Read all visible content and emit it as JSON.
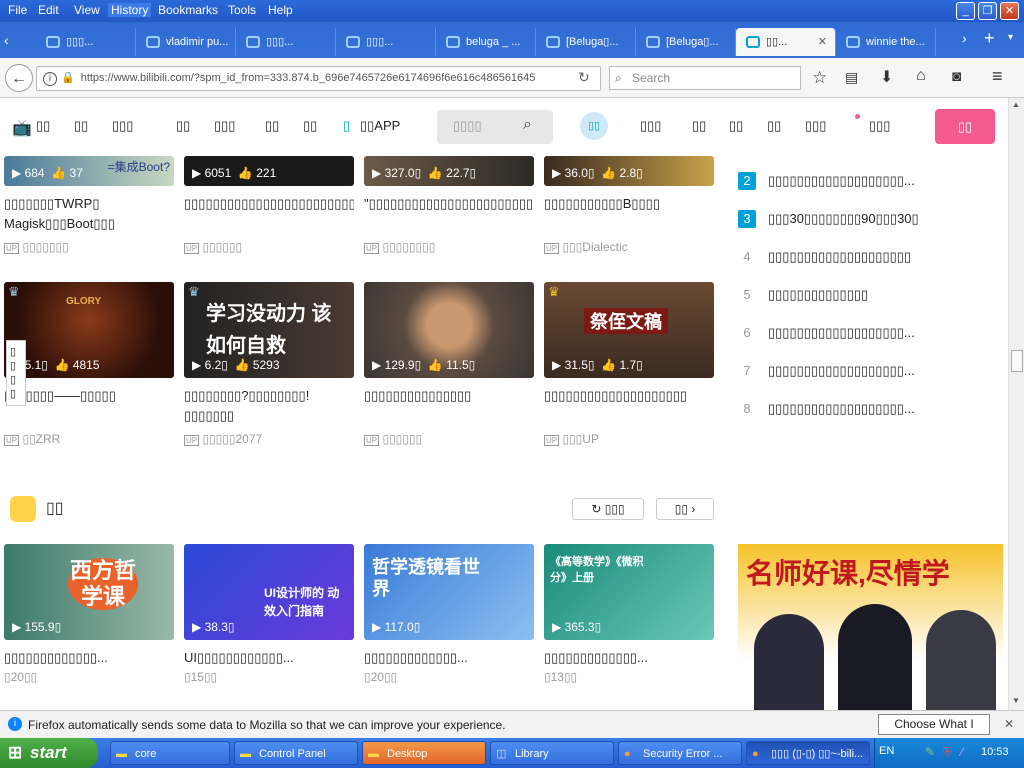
{
  "menubar": {
    "items": [
      "File",
      "Edit",
      "View",
      "History",
      "Bookmarks",
      "Tools",
      "Help"
    ]
  },
  "window_controls": {
    "minimize": "_",
    "restore": "❐",
    "close": "✕"
  },
  "tabs": [
    {
      "label": "▯▯▯..."
    },
    {
      "label": "vladimir pu..."
    },
    {
      "label": "▯▯▯..."
    },
    {
      "label": "▯▯▯..."
    },
    {
      "label": "beluga _ ..."
    },
    {
      "label": "[Beluga▯..."
    },
    {
      "label": "[Beluga▯..."
    },
    {
      "label": "▯▯..."
    },
    {
      "label": "winnie the..."
    }
  ],
  "navbar": {
    "url": "https://www.bilibili.com/?spm_id_from=333.874.b_696e7465726e6174696f6e616c486561645",
    "search_placeholder": "Search"
  },
  "header": {
    "nav": [
      "▯▯",
      "▯▯",
      "▯▯▯",
      "▯▯",
      "▯▯▯",
      "▯▯",
      "▯▯"
    ],
    "app_label": "▯▯APP",
    "search_placeholder": "▯▯▯▯",
    "avatar": "▯▯",
    "right_nav": [
      "▯▯▯",
      "▯▯",
      "▯▯",
      "▯▯",
      "▯▯▯",
      "▯▯▯"
    ],
    "upload": "▯▯"
  },
  "row1": [
    {
      "views": "684",
      "likes": "37",
      "overlay": "=集成Boot?",
      "title": "▯▯▯▯▯▯▯TWRP▯ Magisk▯▯▯Boot▯▯▯",
      "up": "▯▯▯▯▯▯▯"
    },
    {
      "views": "6051",
      "likes": "221",
      "overlay": "",
      "title": "▯▯▯▯▯▯▯▯▯▯▯▯▯▯▯▯▯▯▯▯▯▯▯▯▯",
      "up": "▯▯▯▯▯▯"
    },
    {
      "views": "327.0▯",
      "likes": "22.7▯",
      "overlay": "",
      "title": "\"▯▯▯▯▯▯▯▯▯▯▯▯▯▯▯▯▯▯▯▯▯▯▯▯▯",
      "up": "▯▯▯▯▯▯▯▯"
    },
    {
      "views": "36.0▯",
      "likes": "2.8▯",
      "overlay": "",
      "title": "▯▯▯▯▯▯▯▯▯▯▯B▯▯▯▯",
      "up": "▯▯▯Dialectic"
    }
  ],
  "row2": [
    {
      "views": "5.1▯",
      "likes": "4815",
      "overlay": "GLORY",
      "title": "▯▯▯▯▯▯▯——▯▯▯▯▯",
      "up": "▯▯ZRR"
    },
    {
      "views": "6.2▯",
      "likes": "5293",
      "overlay": "学习没动力 该如何自救",
      "title": "▯▯▯▯▯▯▯▯?▯▯▯▯▯▯▯▯!▯▯▯▯▯▯▯",
      "up": "▯▯▯▯▯2077"
    },
    {
      "views": "129.9▯",
      "likes": "11.5▯",
      "overlay": "",
      "title": "▯▯▯▯▯▯▯▯▯▯▯▯▯▯▯",
      "up": "▯▯▯▯▯▯"
    },
    {
      "views": "31.5▯",
      "likes": "1.7▯",
      "overlay": "祭侄文稿",
      "title": "▯▯▯▯▯▯▯▯▯▯▯▯▯▯▯▯▯▯▯▯",
      "up": "▯▯▯UP"
    }
  ],
  "ranking": [
    {
      "n": "2",
      "t": "▯▯▯▯▯▯▯▯▯▯▯▯▯▯▯▯▯▯▯..."
    },
    {
      "n": "3",
      "t": "▯▯▯30▯▯▯▯▯▯▯▯90▯▯▯30▯"
    },
    {
      "n": "4",
      "t": "▯▯▯▯▯▯▯▯▯▯▯▯▯▯▯▯▯▯▯▯"
    },
    {
      "n": "5",
      "t": "▯▯▯▯▯▯▯▯▯▯▯▯▯▯"
    },
    {
      "n": "6",
      "t": "▯▯▯▯▯▯▯▯▯▯▯▯▯▯▯▯▯▯▯..."
    },
    {
      "n": "7",
      "t": "▯▯▯▯▯▯▯▯▯▯▯▯▯▯▯▯▯▯▯..."
    },
    {
      "n": "8",
      "t": "▯▯▯▯▯▯▯▯▯▯▯▯▯▯▯▯▯▯▯..."
    }
  ],
  "float_panel": "▯▯▯▯",
  "section": {
    "title": "▯▯",
    "refresh": "▯▯▯",
    "more": "▯▯"
  },
  "row3": [
    {
      "views": "155.9▯",
      "overlay": "西方哲学课",
      "title": "▯▯▯▯▯▯▯▯▯▯▯▯▯...",
      "meta": "▯20▯▯"
    },
    {
      "views": "38.3▯",
      "overlay": "UI设计师的 动效入门指南",
      "title": "UI▯▯▯▯▯▯▯▯▯▯▯▯...",
      "meta": "▯15▯▯"
    },
    {
      "views": "117.0▯",
      "overlay": "哲学透镜看世界",
      "title": "▯▯▯▯▯▯▯▯▯▯▯▯▯...",
      "meta": "▯20▯▯"
    },
    {
      "views": "365.3▯",
      "overlay": "《高等数学》《微积分》上册",
      "title": "▯▯▯▯▯▯▯▯▯▯▯▯▯...",
      "meta": "▯13▯▯"
    }
  ],
  "banner": {
    "text": "名师好课,尽情学"
  },
  "notification": {
    "text": "Firefox automatically sends some data to Mozilla so that we can improve your experience.",
    "button": "Choose What I Share",
    "close": "✕"
  },
  "taskbar": {
    "start": "start",
    "items": [
      "core",
      "Control Panel",
      "Desktop",
      "Library",
      "Security Error ...",
      "▯▯▯ (▯-▯) ▯▯~-bili..."
    ],
    "lang": "EN",
    "clock": "10:53"
  },
  "colors": {
    "accent": "#00a1d6",
    "pink": "#f45a8d",
    "xp_blue": "#245ed0"
  }
}
